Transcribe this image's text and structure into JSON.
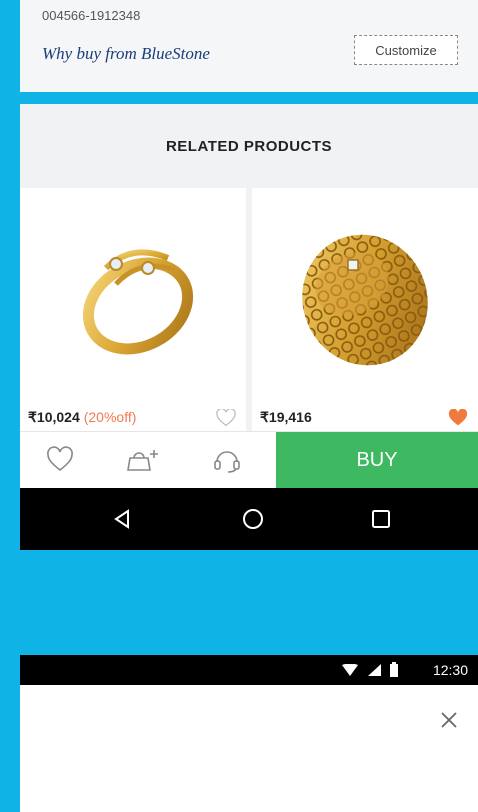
{
  "product_card": {
    "code": "004566-1912348",
    "why_buy": "Why buy from BlueStone",
    "customize_label": "Customize"
  },
  "related": {
    "title": "RELATED PRODUCTS",
    "products": [
      {
        "image": "gold-diamond-bypass-ring",
        "price": "₹10,024",
        "discount": "(20%off)",
        "favorited": false
      },
      {
        "image": "gold-lattice-band-ring",
        "price": "₹19,416",
        "discount": "",
        "favorited": true
      }
    ]
  },
  "actions": {
    "wishlist_icon": "heart-outline-icon",
    "add_to_cart_icon": "bag-plus-icon",
    "support_icon": "headset-icon",
    "buy_label": "BUY"
  },
  "nav": {
    "back": "back-triangle-icon",
    "home": "home-circle-icon",
    "recents": "recents-square-icon"
  },
  "status_bar": {
    "time": "12:30"
  },
  "colors": {
    "accent_blue": "#0fb3e5",
    "buy_green": "#3fb862",
    "discount_orange": "#f37a4e",
    "heart_filled": "#f07a3e",
    "brand_navy": "#1c3d7a"
  }
}
